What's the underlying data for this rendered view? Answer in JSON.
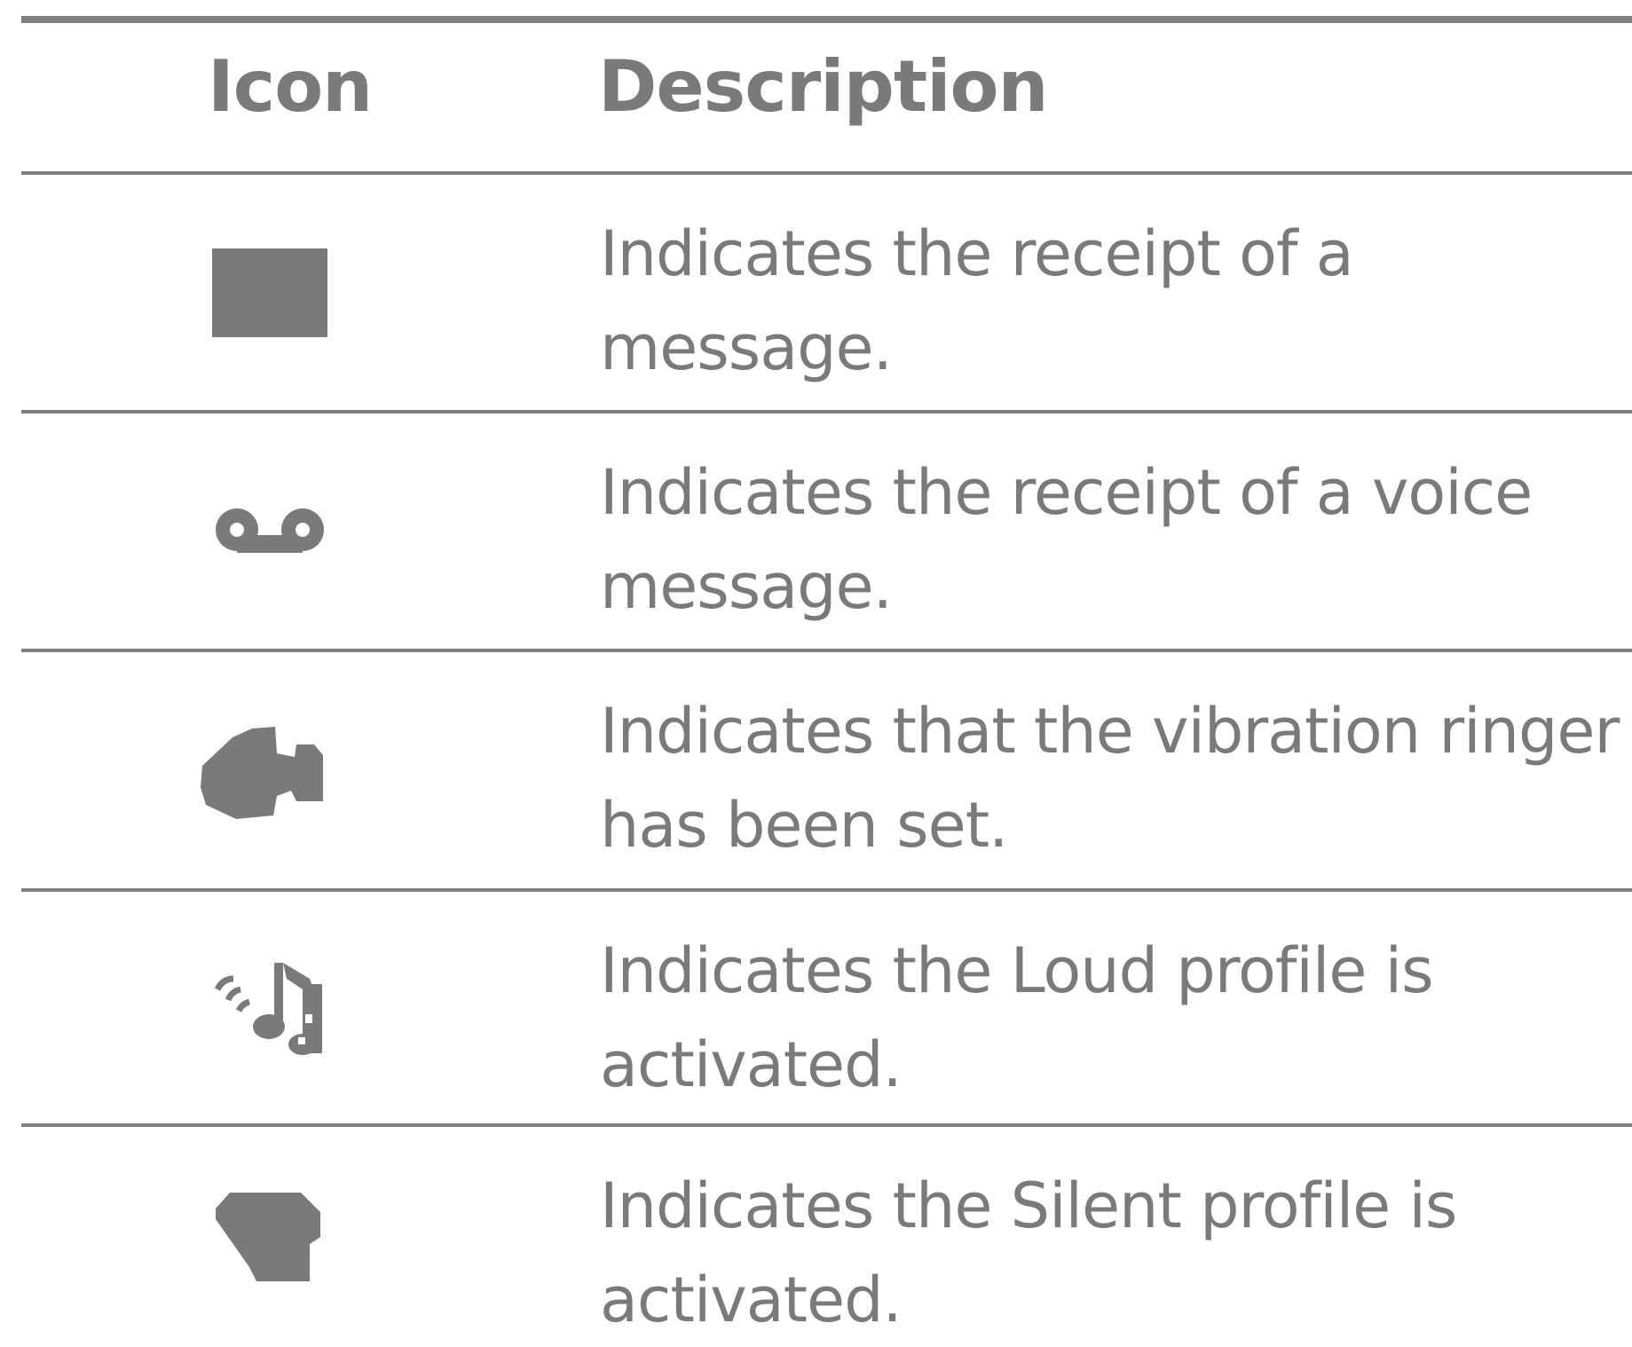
{
  "table": {
    "headers": {
      "icon": "Icon",
      "description": "Description"
    },
    "rows": [
      {
        "icon": "message-icon",
        "line1": "Indicates the receipt of a",
        "line2": "message."
      },
      {
        "icon": "voicemail-icon",
        "line1": "Indicates the receipt of a voice",
        "line2": "message."
      },
      {
        "icon": "vibration-icon",
        "line1": "Indicates that the vibration ringer",
        "line2": "has been set."
      },
      {
        "icon": "loud-profile-icon",
        "line1": "Indicates the Loud profile is",
        "line2": "activated."
      },
      {
        "icon": "silent-profile-icon",
        "line1": "Indicates the Silent profile is",
        "line2": "activated."
      }
    ]
  },
  "colors": {
    "text": "#7a7a7a",
    "rule": "#808080",
    "icon": "#7a7a7a"
  }
}
